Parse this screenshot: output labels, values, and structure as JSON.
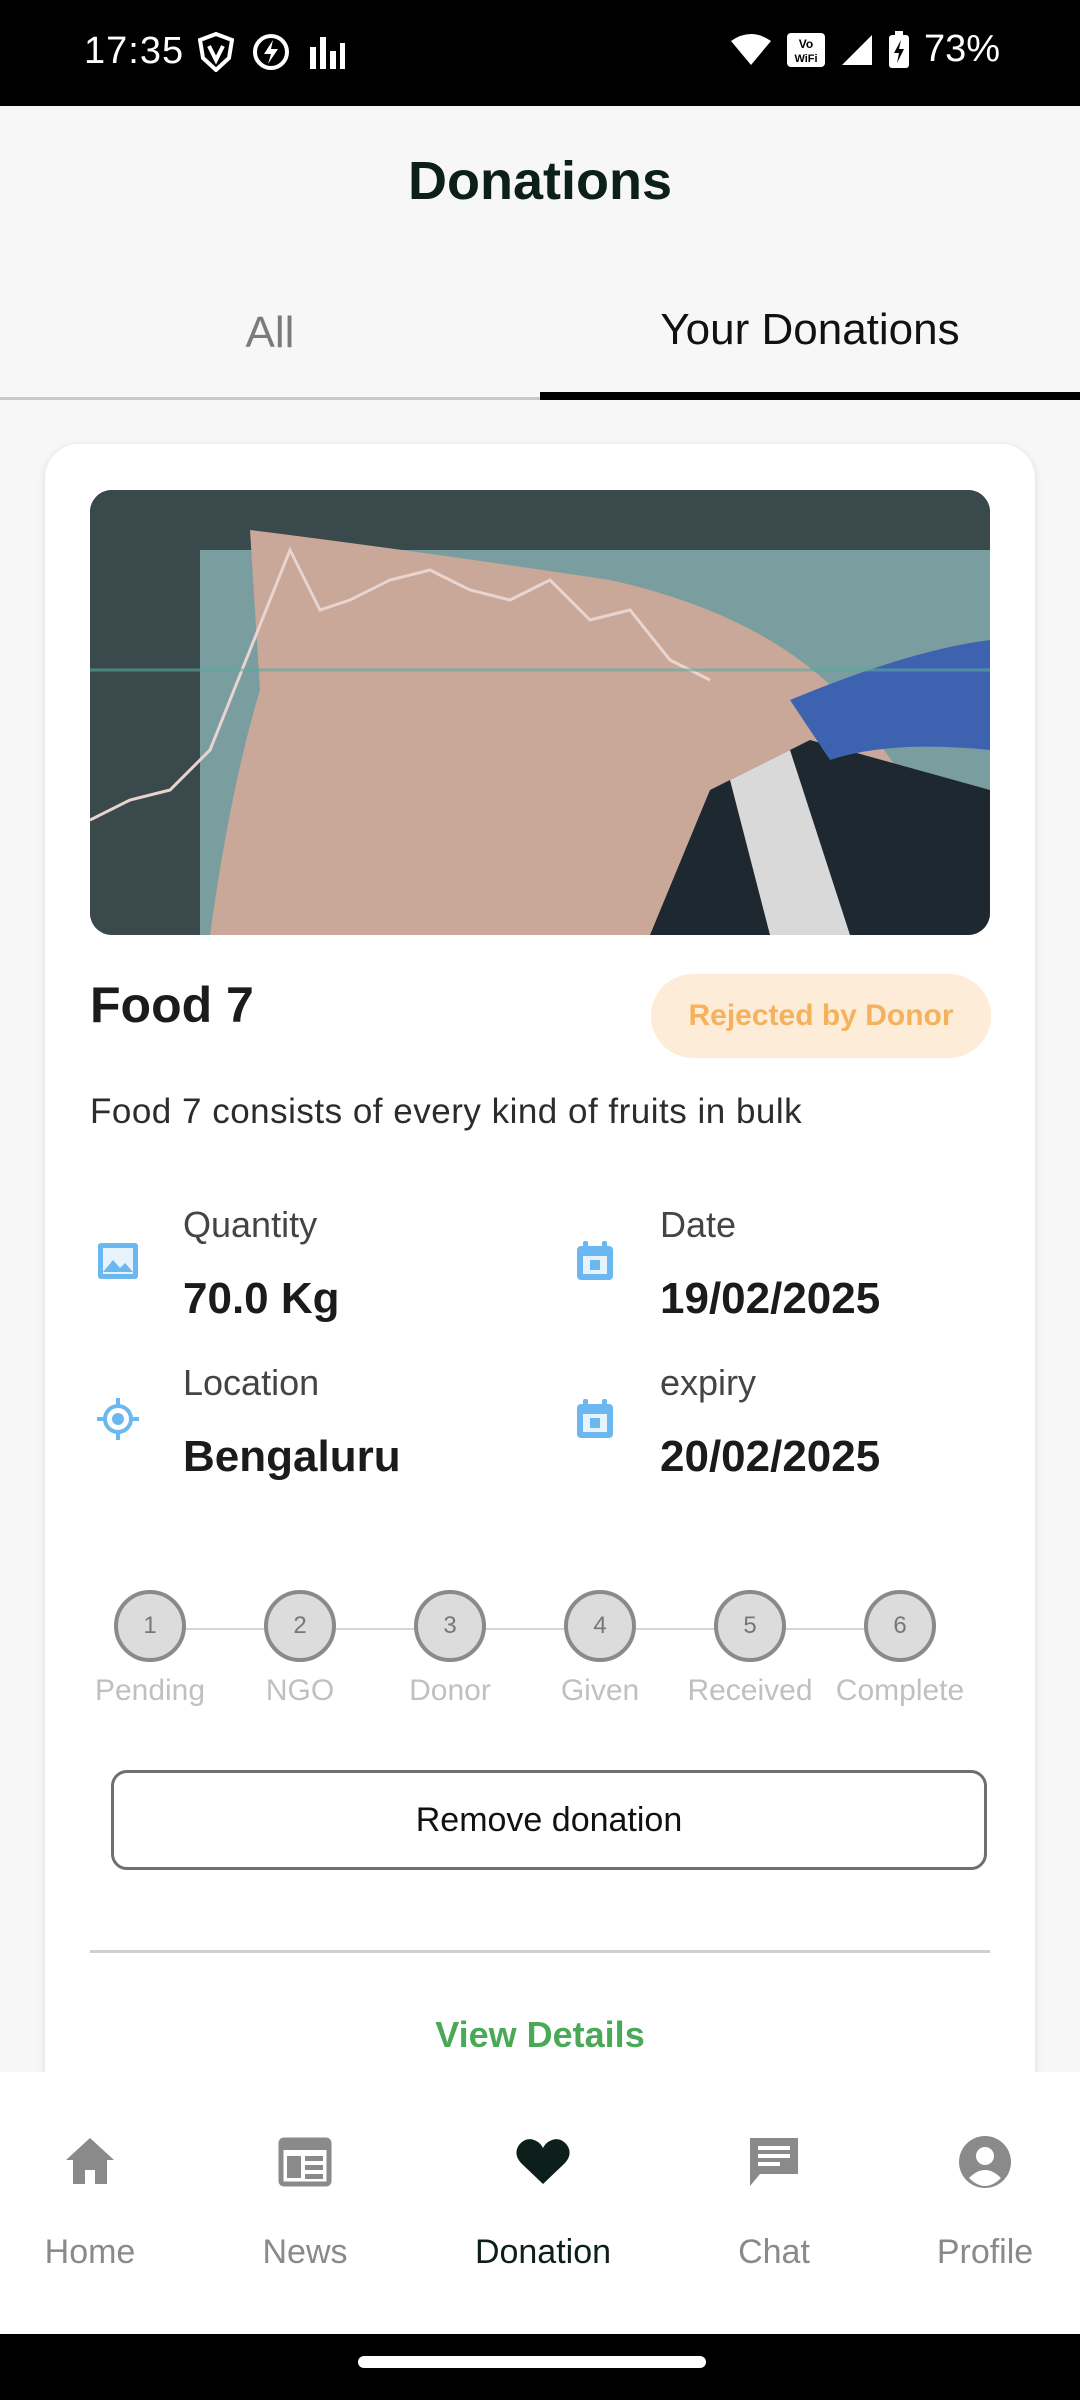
{
  "status_bar": {
    "time": "17:35",
    "battery": "73%",
    "icons": [
      "vpn-shield-icon",
      "bolt-icon",
      "bars-icon",
      "wifi-icon",
      "vowifi-icon",
      "signal-icon",
      "battery-charging-icon"
    ]
  },
  "header": {
    "title": "Donations"
  },
  "tabs": [
    {
      "label": "All",
      "selected": false
    },
    {
      "label": "Your Donations",
      "selected": true
    }
  ],
  "donation": {
    "image": "food-photo",
    "title": "Food 7",
    "status": "Rejected by Donor",
    "description": "Food 7 consists of every kind of fruits in bulk",
    "quantity": {
      "label": "Quantity",
      "value": "70.0 Kg",
      "icon": "image-icon"
    },
    "date": {
      "label": "Date",
      "value": "19/02/2025",
      "icon": "calendar-icon"
    },
    "location": {
      "label": "Location",
      "value": "Bengaluru",
      "icon": "location-target-icon"
    },
    "expiry": {
      "label": "expiry",
      "value": "20/02/2025",
      "icon": "calendar-icon"
    },
    "steps": [
      {
        "number": "1",
        "label": "Pending"
      },
      {
        "number": "2",
        "label": "NGO"
      },
      {
        "number": "3",
        "label": "Donor"
      },
      {
        "number": "4",
        "label": "Given"
      },
      {
        "number": "5",
        "label": "Received"
      },
      {
        "number": "6",
        "label": "Complete"
      }
    ],
    "remove_label": "Remove donation",
    "view_details_label": "View Details"
  },
  "bottom_nav": [
    {
      "label": "Home",
      "icon": "home-icon",
      "active": false
    },
    {
      "label": "News",
      "icon": "news-icon",
      "active": false
    },
    {
      "label": "Donation",
      "icon": "heart-icon",
      "active": true
    },
    {
      "label": "Chat",
      "icon": "chat-icon",
      "active": false
    },
    {
      "label": "Profile",
      "icon": "profile-icon",
      "active": false
    }
  ],
  "colors": {
    "accent_dark": "#0c1f1a",
    "badge_bg": "#fdecd7",
    "badge_text": "#f6b15c",
    "icon_blue": "#6bb8f0",
    "link_green": "#4aa957"
  }
}
